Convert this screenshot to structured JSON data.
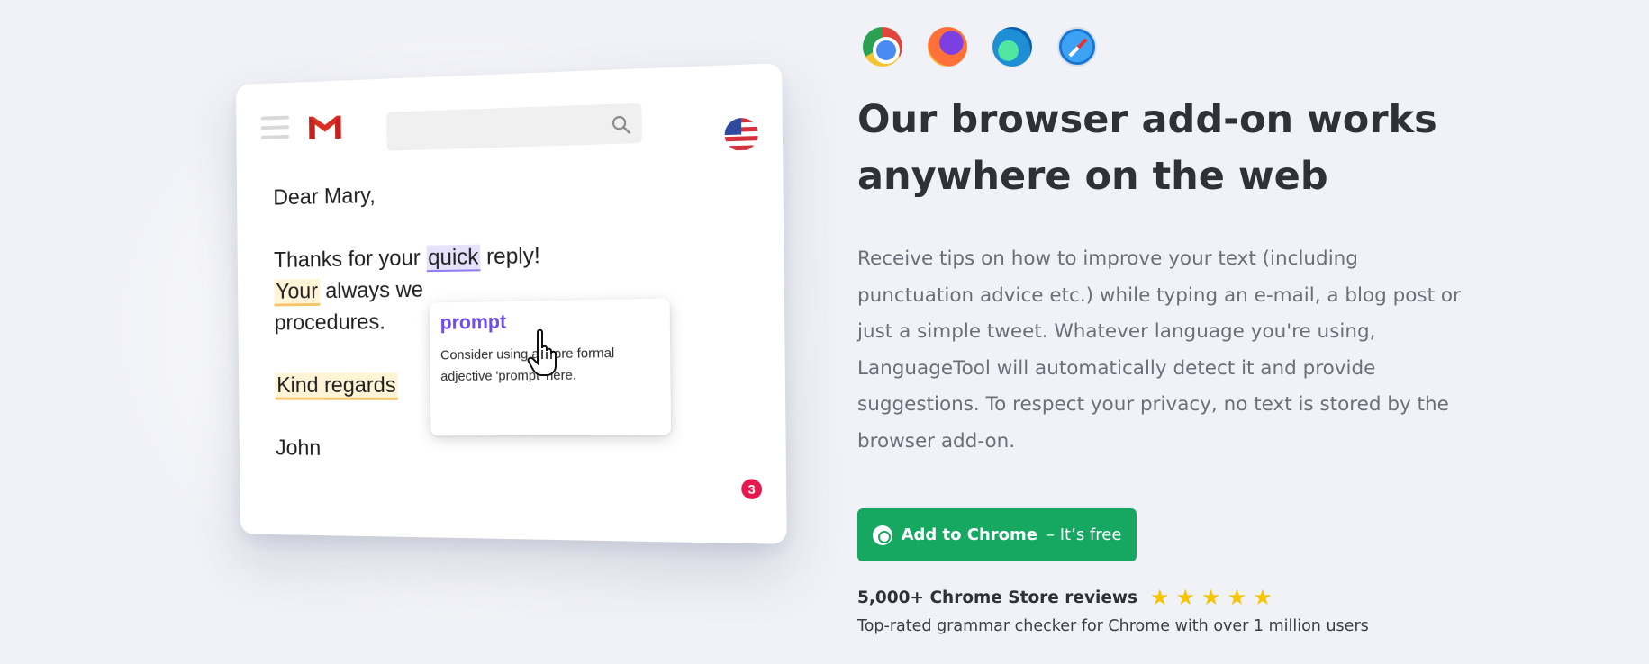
{
  "illustration": {
    "badge_count": "3",
    "mail": {
      "greeting": "Dear Mary,",
      "line1_before": "Thanks for your ",
      "line1_highlight": "quick",
      "line1_after": " reply!",
      "line2_highlight": "Your",
      "line2_after": " always we",
      "line3": "procedures.",
      "closing": "Kind regards",
      "signature": "John"
    },
    "suggestion": {
      "word": "prompt",
      "hint": "Consider using a more formal adjective 'prompt' here."
    }
  },
  "browsers": [
    "chrome-icon",
    "firefox-icon",
    "edge-icon",
    "safari-icon"
  ],
  "headline": "Our browser add-on works anywhere on the web",
  "description": "Receive tips on how to improve your text (including punctuation advice etc.) while typing an e-mail, a blog post or just a simple tweet. Whatever language you're using, LanguageTool will automatically detect it and provide suggestions. To respect your privacy, no text is stored by the browser add-on.",
  "cta": {
    "strong": "Add to Chrome",
    "rest": "– It’s free"
  },
  "reviews": {
    "title": "5,000+ Chrome Store reviews",
    "stars": 5,
    "subtext": "Top-rated grammar checker for Chrome with over 1 million users"
  },
  "colors": {
    "background": "#f1f2f7",
    "cta_green": "#16a861",
    "suggestion_purple": "#6c4df2",
    "star_yellow": "#f6c400",
    "badge_red": "#e5194e"
  }
}
